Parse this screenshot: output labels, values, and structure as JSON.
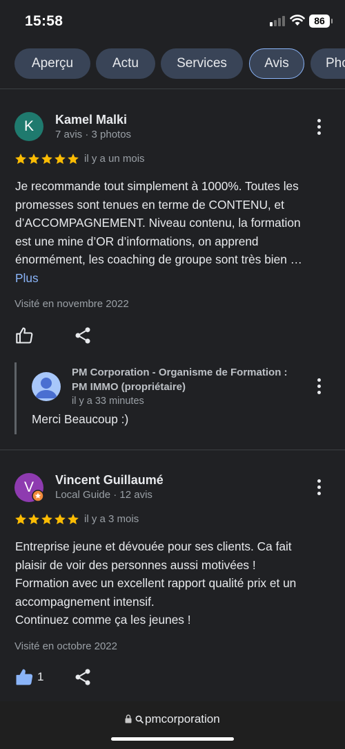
{
  "status_bar": {
    "time": "15:58",
    "battery": "86"
  },
  "tabs": [
    {
      "label": "Aperçu",
      "active": false
    },
    {
      "label": "Actu",
      "active": false
    },
    {
      "label": "Services",
      "active": false
    },
    {
      "label": "Avis",
      "active": true
    },
    {
      "label": "Pho",
      "active": false
    }
  ],
  "reviews": [
    {
      "initial": "K",
      "avatar_color": "#1f7a6e",
      "name": "Kamel Malki",
      "meta": "7 avis · 3 photos",
      "rating": 5,
      "date": "il y a un mois",
      "text_lines": [
        "Je recommande tout simplement à 1000%. Toutes les",
        "promesses sont tenues en terme de CONTENU, et",
        "d’ACCOMPAGNEMENT. Niveau contenu, la formation",
        "est une mine d’OR d’informations, on apprend",
        "énormément, les coaching de groupe sont très bien …"
      ],
      "more_label": "Plus",
      "visited": "Visité en novembre 2022",
      "likes": "",
      "reply": {
        "name_lines": [
          "PM Corporation - Organisme de Formation :",
          "PM IMMO (propriétaire)"
        ],
        "time": "il y a 33 minutes",
        "text": "Merci Beaucoup :)"
      }
    },
    {
      "initial": "V",
      "avatar_color": "#8e3bb0",
      "name": "Vincent Guillaumé",
      "meta": "Local Guide · 12 avis",
      "rating": 5,
      "date": "il y a 3 mois",
      "text_lines": [
        "Entreprise jeune et dévouée pour ses clients. Ca fait",
        "plaisir de voir des personnes aussi motivées !",
        "Formation avec un excellent rapport qualité prix et un",
        "accompagnement intensif.",
        "Continuez comme ça les jeunes !"
      ],
      "visited": "Visité en octobre 2022",
      "likes": "1"
    }
  ],
  "browser": {
    "url": "pmcorporation"
  },
  "colors": {
    "star": "#fbbc04",
    "link": "#8ab4f8",
    "like_active": "#8ab4f8",
    "badge": "#f28b3b"
  }
}
